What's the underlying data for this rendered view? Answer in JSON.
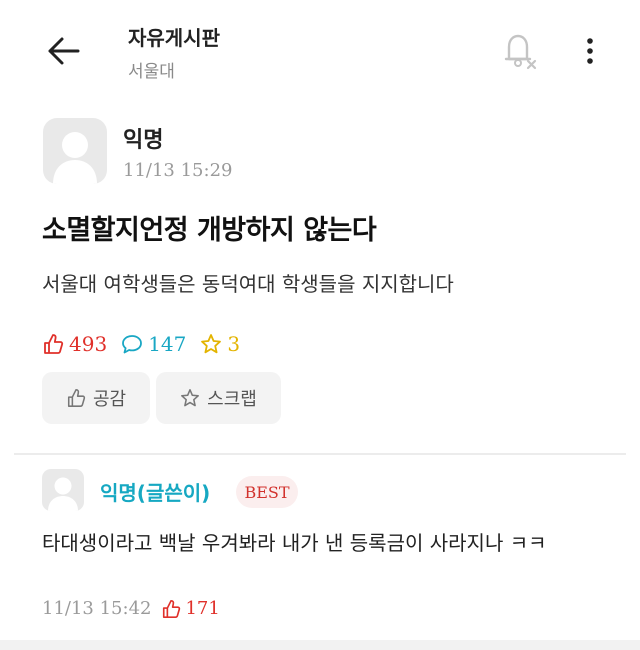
{
  "header": {
    "title": "자유게시판",
    "subtitle": "서울대"
  },
  "post": {
    "author": "익명",
    "time": "11/13 15:29",
    "title": "소멸할지언정 개방하지 않는다",
    "body": "서울대 여학생들은 동덕여대 학생들을 지지합니다",
    "likes": "493",
    "comments": "147",
    "scraps": "3",
    "like_button_label": "공감",
    "scrap_button_label": "스크랩"
  },
  "comment": {
    "author": "익명(글쓴이)",
    "badge": "BEST",
    "body": "타대생이라고 백날 우겨봐라 내가 낸 등록금이 사라지나 ㅋㅋ",
    "time": "11/13 15:42",
    "likes": "171"
  },
  "colors": {
    "like": "#e0302a",
    "comment": "#19a7c4",
    "scrap": "#e3b400",
    "best_badge_bg": "#fbeeee",
    "comment_author": "#16a8c2"
  },
  "icons": [
    "back-arrow-icon",
    "bell-off-icon",
    "more-vertical-icon",
    "thumbs-up-icon",
    "comment-icon",
    "star-icon"
  ]
}
